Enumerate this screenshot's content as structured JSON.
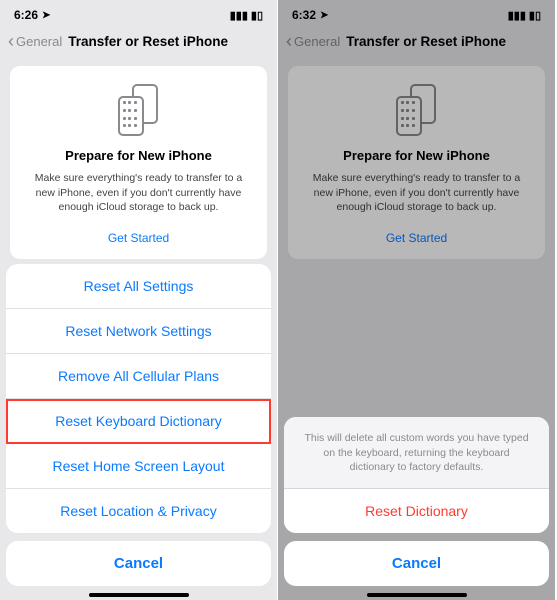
{
  "left": {
    "status": {
      "time": "6:26",
      "location_glyph": "➤",
      "signal_glyph": "▮▮▮",
      "battery_glyph": "▮▯"
    },
    "nav": {
      "back_label": "General",
      "title": "Transfer or Reset iPhone"
    },
    "card": {
      "title": "Prepare for New iPhone",
      "desc": "Make sure everything's ready to transfer to a new iPhone, even if you don't currently have enough iCloud storage to back up.",
      "cta": "Get Started"
    },
    "sheet": {
      "items": [
        {
          "label": "Reset All Settings",
          "highlighted": false
        },
        {
          "label": "Reset Network Settings",
          "highlighted": false
        },
        {
          "label": "Remove All Cellular Plans",
          "highlighted": false
        },
        {
          "label": "Reset Keyboard Dictionary",
          "highlighted": true
        },
        {
          "label": "Reset Home Screen Layout",
          "highlighted": false
        },
        {
          "label": "Reset Location & Privacy",
          "highlighted": false
        }
      ],
      "cancel": "Cancel"
    }
  },
  "right": {
    "status": {
      "time": "6:32",
      "location_glyph": "➤",
      "signal_glyph": "▮▮▮",
      "battery_glyph": "▮▯"
    },
    "nav": {
      "back_label": "General",
      "title": "Transfer or Reset iPhone"
    },
    "card": {
      "title": "Prepare for New iPhone",
      "desc": "Make sure everything's ready to transfer to a new iPhone, even if you don't currently have enough iCloud storage to back up.",
      "cta": "Get Started"
    },
    "confirm": {
      "message": "This will delete all custom words you have typed on the keyboard, returning the keyboard dictionary to factory defaults.",
      "action": "Reset Dictionary",
      "cancel": "Cancel"
    }
  }
}
